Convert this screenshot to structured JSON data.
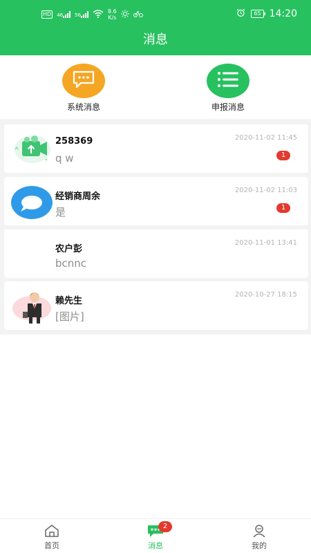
{
  "status_bar": {
    "hd_label": "HD",
    "signal_1": "46",
    "signal_2": "56",
    "net_speed_value": "8.6",
    "net_speed_unit": "K/s",
    "battery": "65",
    "time": "14:20",
    "icons": [
      "hd-icon",
      "signal-icon",
      "wifi-icon",
      "brightness-icon",
      "bike-icon",
      "alarm-icon",
      "battery-icon"
    ]
  },
  "header": {
    "title": "消息"
  },
  "categories": {
    "system": {
      "label": "系统消息",
      "icon": "chat-dots-icon",
      "color": "#f5a623"
    },
    "report": {
      "label": "申报消息",
      "icon": "list-icon",
      "color": "#27c15f"
    }
  },
  "conversations": [
    {
      "name": "258369",
      "preview": "q w",
      "time": "2020-11-02 11:45",
      "unread": "1",
      "avatar": "upload-box-avatar"
    },
    {
      "name": "经销商周余",
      "preview": "是",
      "time": "2020-11-02 11:03",
      "unread": "1",
      "avatar": "blue-chat-bubble-avatar"
    },
    {
      "name": "农户彭",
      "preview": "bcnnc",
      "time": "2020-11-01 13:41",
      "unread": "",
      "avatar": "blank-avatar"
    },
    {
      "name": "赖先生",
      "preview": "[图片]",
      "time": "2020-10-27 18:15",
      "unread": "",
      "avatar": "businessman-avatar"
    }
  ],
  "bottom_nav": {
    "home": {
      "label": "首页",
      "icon": "home-icon"
    },
    "messages": {
      "label": "消息",
      "icon": "message-icon",
      "badge": "2"
    },
    "mine": {
      "label": "我的",
      "icon": "user-icon"
    }
  },
  "colors": {
    "primary": "#27c15f",
    "badge": "#e23a2f",
    "orange": "#f5a623"
  }
}
